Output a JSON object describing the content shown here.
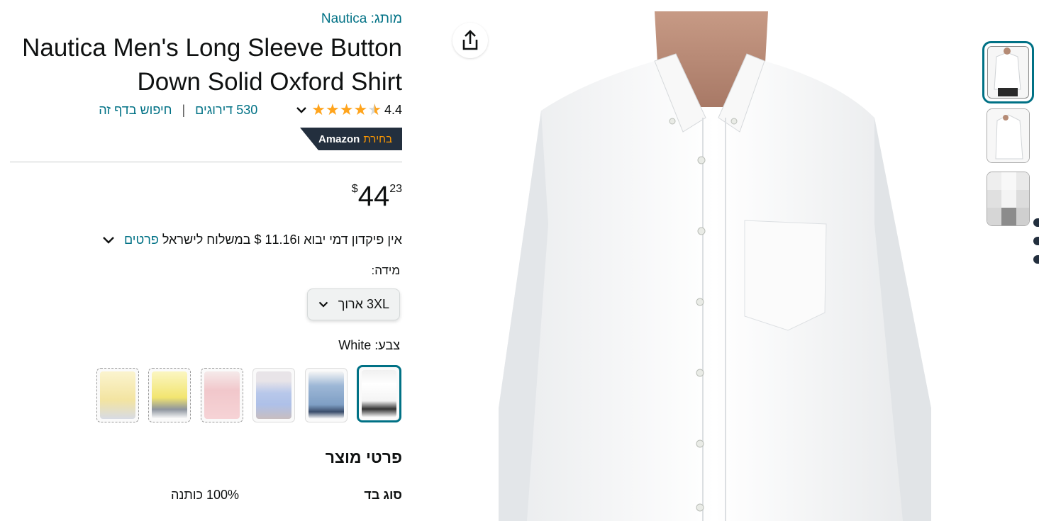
{
  "product": {
    "brand_prefix": "מותג:",
    "brand_name": "Nautica",
    "title": "Nautica Men's Long Sleeve Button Down Solid Oxford Shirt",
    "rating_value": "4.4",
    "rating_stars": 4.4,
    "ratings_count": "530 דירוגים",
    "search_page": "חיפוש בדף זה",
    "ratings_separator": "|",
    "badge_word": "בחירת",
    "badge_brand": "Amazon"
  },
  "price": {
    "currency": "$",
    "whole": "44",
    "fraction": "23"
  },
  "shipping": {
    "text": "אין פיקדון דמי יבוא ו11.16 $ במשלוח לישראל",
    "details_link": "פרטים"
  },
  "size": {
    "label": "מידה:",
    "selected": "3XL ארוך"
  },
  "color": {
    "label": "צבע:",
    "selected": "White",
    "swatches": [
      {
        "name": "White",
        "selected": true
      },
      {
        "name": "Blue",
        "selected": false
      },
      {
        "name": "Light Blue",
        "selected": false
      },
      {
        "name": "Pink",
        "selected": false
      },
      {
        "name": "Yellow",
        "selected": false
      },
      {
        "name": "Light Yellow",
        "selected": false
      }
    ]
  },
  "details": {
    "title": "פרטי מוצר",
    "rows": [
      {
        "key": "סוג בד",
        "value": "100% כותנה"
      }
    ]
  },
  "gallery": {
    "share_icon": "share-icon",
    "thumbnails": [
      "front-view",
      "side-view",
      "pixelated-view"
    ]
  },
  "colors": {
    "accent": "#007185",
    "star": "#FFA41C",
    "badge_bg": "#232F3E",
    "badge_word": "#FF9900"
  }
}
